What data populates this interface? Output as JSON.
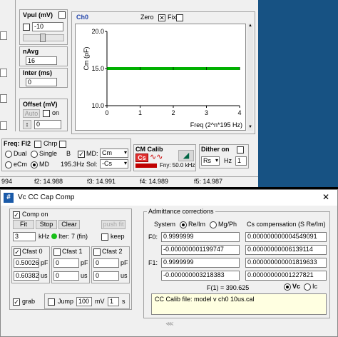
{
  "left_panel": {
    "vpul_label": "Vpul (mV)",
    "vpul_value": "-10",
    "navg_label": "nAvg",
    "navg_value": "16",
    "inter_label": "Inter (ms)",
    "inter_value": "0",
    "offset_label": "Offset (mV)",
    "offset_auto": "Auto",
    "offset_on": "on",
    "offset_value": "0"
  },
  "chart_panel": {
    "title": "Ch0",
    "zero_label": "Zero",
    "fix_label": "Fix"
  },
  "chart_data": {
    "type": "line",
    "ylabel": "Cm (pF)",
    "xlabel": "Freq (2^n*195 Hz)",
    "ylim": [
      10.0,
      20.0
    ],
    "xlim": [
      0,
      4
    ],
    "y_ticks": [
      "20.0",
      "15.0",
      "10.0"
    ],
    "x_ticks": [
      "0",
      "1",
      "2",
      "3",
      "4"
    ],
    "series": [
      {
        "x": [
          0,
          1,
          2,
          3,
          4
        ],
        "y": [
          15.0,
          15.0,
          15.0,
          15.0,
          15.0
        ]
      }
    ],
    "grid": false,
    "line_color": "#00b000"
  },
  "controls_row": {
    "freq_label": "Freq: FI2",
    "chrp_label": "Chrp",
    "dual": "Dual",
    "single": "Single",
    "b_label": "B",
    "md_label": "MD:",
    "md_value": "Cm",
    "ecm": "eCm",
    "md2": "MD",
    "freq_hz": "195.3Hz",
    "sol_label": "Sol:",
    "sol_value": "-Cs",
    "cm_calib_label": "CM Calib",
    "cs_label": "Cs",
    "fny_label": "Fny: 50.0 kHz",
    "dither_label": "Dither on",
    "rs_value": "Rs",
    "hz_label": "Hz",
    "hz_value": "1"
  },
  "freq_strip": [
    "994",
    "f2: 14.988",
    "f3: 14.991",
    "f4: 14.989",
    "f5: 14.987"
  ],
  "dialog": {
    "title": "Vc CC Cap Comp",
    "comp_on": "Comp on",
    "fit": "Fit",
    "stop": "Stop",
    "clear": "Clear",
    "push_label": "push fit",
    "khz_value": "3",
    "khz_label": "kHz",
    "iter_label": "Iter: 7 (fin)",
    "keep_label": "keep",
    "cfast0": "Cfast 0",
    "cfast1": "Cfast 1",
    "cfast2": "Cfast 2",
    "c0_pf": "0.50026",
    "c0_us": "0.60382",
    "c1_pf": "0",
    "c1_us": "0",
    "c2_pf": "0",
    "c2_us": "0",
    "pf_unit": "pF",
    "us_unit": "us",
    "grab_label": "grab",
    "jump_label": "Jump",
    "jump_value": "100",
    "mv_label": "mV",
    "s_value": "1",
    "s_label": "s",
    "adm_title": "Admittance corrections",
    "system_label": "System",
    "reim_label": "Re/Im",
    "mgph_label": "Mg/Ph",
    "cs_comp_label": "Cs compensation (S Re/Im)",
    "f0_label": "F0:",
    "f1_label": "F1:",
    "sys_values": [
      "0.9999999",
      "-0.000000001199747",
      "0.9999999",
      "-0.000000003218383"
    ],
    "cs_values": [
      "0.000000000004549091",
      "0.00000000006139114",
      "0.000000000001819633",
      "0.00000000001227821"
    ],
    "f1_readout": "F(1) =  390.625",
    "vc_label": "Vc",
    "ic_label": "Ic",
    "file_text": "CC Calib file: model v ch0 10us.cal"
  }
}
